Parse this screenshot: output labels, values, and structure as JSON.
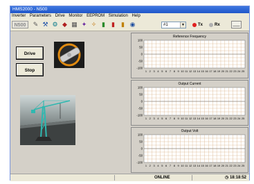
{
  "window": {
    "title": "HMS2000 - N500"
  },
  "menu": [
    "Inverter",
    "Parameters",
    "Drive",
    "Monitor",
    "EEPROM",
    "Simulation",
    "Help"
  ],
  "toolbar": {
    "logo": "N500",
    "tool_icons": [
      "wrench-icon",
      "hammer-icon",
      "gear-icon",
      "car-icon",
      "chip-icon",
      "magic-icon",
      "tools-icon",
      "bottle-icon",
      "bottle-icon",
      "bottle-icon",
      "disk-icon"
    ],
    "select_value": "#1",
    "tx_label": "Tx",
    "rx_label": "Rx",
    "extra_button": "___",
    "colors": {
      "tx_led": "#e02020",
      "rx_led": "#b0b0b0"
    }
  },
  "buttons": {
    "drive": "Drive",
    "stop": "Stop"
  },
  "charts": {
    "y_ticks": [
      "100",
      "50",
      "0",
      "-50",
      "-100"
    ],
    "x_ticks": [
      "1",
      "2",
      "3",
      "4",
      "5",
      "6",
      "7",
      "8",
      "9",
      "10",
      "11",
      "12",
      "13",
      "14",
      "15",
      "16",
      "17",
      "18",
      "19",
      "20",
      "21",
      "22",
      "23",
      "24",
      "25"
    ],
    "titles": [
      "Reference Frequency",
      "Output Current",
      "Output Volt"
    ]
  },
  "status": {
    "connection": "ONLINE",
    "time": "18:18:52"
  }
}
